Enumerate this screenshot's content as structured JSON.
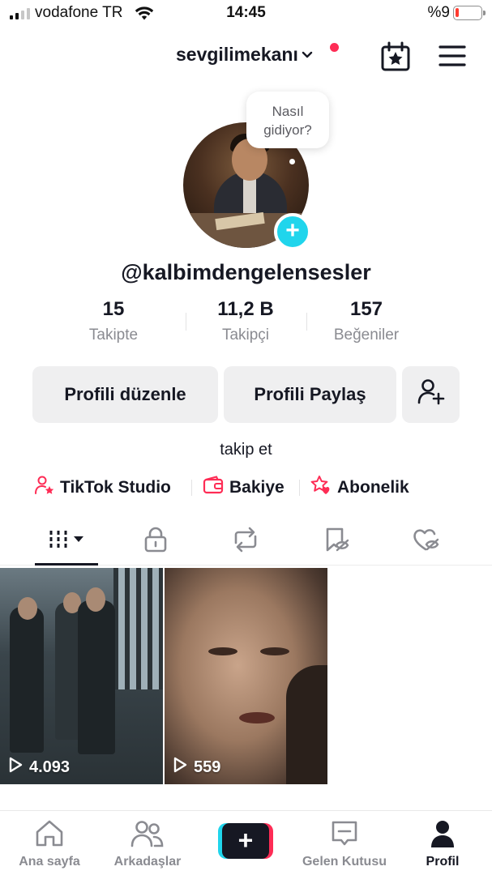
{
  "status_bar": {
    "carrier": "vodafone TR",
    "time": "14:45",
    "battery": "%9"
  },
  "header": {
    "username": "sevgilimekanı",
    "icons": [
      "chevron-down-icon",
      "calendar-star-icon",
      "hamburger-menu-icon"
    ],
    "notification_dot_color": "#fe2c55"
  },
  "profile": {
    "bubble_text": "Nasıl gidiyor?",
    "handle": "@kalbimdengelensesler",
    "accent_color": "#20d5ec"
  },
  "stats": [
    {
      "value": "15",
      "label": "Takipte"
    },
    {
      "value": "11,2 B",
      "label": "Takipçi"
    },
    {
      "value": "157",
      "label": "Beğeniler"
    }
  ],
  "buttons": {
    "edit_profile": "Profili düzenle",
    "share_profile": "Profili Paylaş"
  },
  "follow_text": "takip et",
  "shortcuts": [
    {
      "label": "TikTok Studio",
      "icon": "person-star-icon"
    },
    {
      "label": "Bakiye",
      "icon": "wallet-icon"
    },
    {
      "label": "Abonelik",
      "icon": "star-heart-icon"
    }
  ],
  "tabs": [
    {
      "icon": "grid-icon",
      "active": true
    },
    {
      "icon": "lock-icon"
    },
    {
      "icon": "repost-icon"
    },
    {
      "icon": "bookmark-icon"
    },
    {
      "icon": "liked-icon"
    }
  ],
  "videos": [
    {
      "views": "4.093"
    },
    {
      "views": "559"
    }
  ],
  "bottom_nav": [
    {
      "label": "Ana sayfa",
      "icon": "home-icon"
    },
    {
      "label": "Arkadaşlar",
      "icon": "friends-icon"
    },
    {
      "label": "",
      "icon": "plus-icon"
    },
    {
      "label": "Gelen Kutusu",
      "icon": "inbox-icon"
    },
    {
      "label": "Profil",
      "icon": "profile-icon",
      "active": true
    }
  ]
}
